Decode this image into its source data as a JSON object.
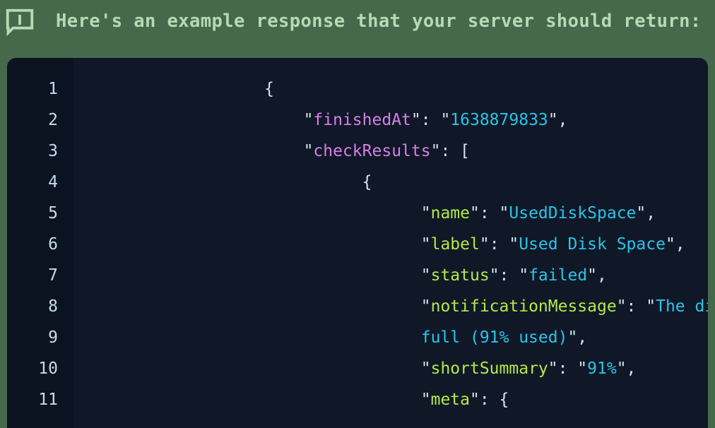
{
  "header": {
    "icon": "info-message-icon",
    "text": "Here's an example response that your server should return:",
    "background_color": "#47694b",
    "text_color": "#b9d9b3"
  },
  "code_block": {
    "language": "json",
    "background_color": "#101827",
    "gutter_color": "#0c1320",
    "line_number_color": "#c5dcf0",
    "colors": {
      "punctuation": "#d5e3f0",
      "key_toplevel": "#d67fe8",
      "key_nested": "#b4e84a",
      "string": "#29c5e8"
    },
    "line_numbers": [
      "1",
      "2",
      "3",
      "4",
      "5",
      "6",
      "7",
      "8",
      "9",
      "10",
      "11"
    ],
    "lines": [
      {
        "number": "1",
        "indent": 6,
        "tokens": [
          {
            "t": "{",
            "c": "punct"
          }
        ]
      },
      {
        "number": "2",
        "indent": 8,
        "tokens": [
          {
            "t": "\"",
            "c": "punct"
          },
          {
            "t": "finishedAt",
            "c": "key-a"
          },
          {
            "t": "\": \"",
            "c": "punct"
          },
          {
            "t": "1638879833",
            "c": "str"
          },
          {
            "t": "\",",
            "c": "punct"
          }
        ]
      },
      {
        "number": "3",
        "indent": 8,
        "tokens": [
          {
            "t": "\"",
            "c": "punct"
          },
          {
            "t": "checkResults",
            "c": "key-a"
          },
          {
            "t": "\": [",
            "c": "punct"
          }
        ]
      },
      {
        "number": "4",
        "indent": 11,
        "tokens": [
          {
            "t": "{",
            "c": "punct"
          }
        ]
      },
      {
        "number": "5",
        "indent": 14,
        "tokens": [
          {
            "t": "\"",
            "c": "punct"
          },
          {
            "t": "name",
            "c": "key-b"
          },
          {
            "t": "\": \"",
            "c": "punct"
          },
          {
            "t": "UsedDiskSpace",
            "c": "str"
          },
          {
            "t": "\",",
            "c": "punct"
          }
        ]
      },
      {
        "number": "6",
        "indent": 14,
        "tokens": [
          {
            "t": "\"",
            "c": "punct"
          },
          {
            "t": "label",
            "c": "key-b"
          },
          {
            "t": "\": \"",
            "c": "punct"
          },
          {
            "t": "Used Disk Space",
            "c": "str"
          },
          {
            "t": "\",",
            "c": "punct"
          }
        ]
      },
      {
        "number": "7",
        "indent": 14,
        "tokens": [
          {
            "t": "\"",
            "c": "punct"
          },
          {
            "t": "status",
            "c": "key-b"
          },
          {
            "t": "\": \"",
            "c": "punct"
          },
          {
            "t": "failed",
            "c": "str"
          },
          {
            "t": "\",",
            "c": "punct"
          }
        ]
      },
      {
        "number": "8",
        "indent": 14,
        "tokens": [
          {
            "t": "\"",
            "c": "punct"
          },
          {
            "t": "notificationMessage",
            "c": "key-b"
          },
          {
            "t": "\": \"",
            "c": "punct"
          },
          {
            "t": "The disk is almost",
            "c": "str"
          }
        ]
      },
      {
        "number": "9",
        "indent": 14,
        "tokens": [
          {
            "t": "full (91% used)",
            "c": "str"
          },
          {
            "t": "\",",
            "c": "punct"
          }
        ]
      },
      {
        "number": "10",
        "indent": 14,
        "tokens": [
          {
            "t": "\"",
            "c": "punct"
          },
          {
            "t": "shortSummary",
            "c": "key-b"
          },
          {
            "t": "\": \"",
            "c": "punct"
          },
          {
            "t": "91%",
            "c": "str"
          },
          {
            "t": "\",",
            "c": "punct"
          }
        ]
      },
      {
        "number": "11",
        "indent": 14,
        "tokens": [
          {
            "t": "\"",
            "c": "punct"
          },
          {
            "t": "meta",
            "c": "key-b"
          },
          {
            "t": "\": {",
            "c": "punct"
          }
        ]
      }
    ]
  }
}
